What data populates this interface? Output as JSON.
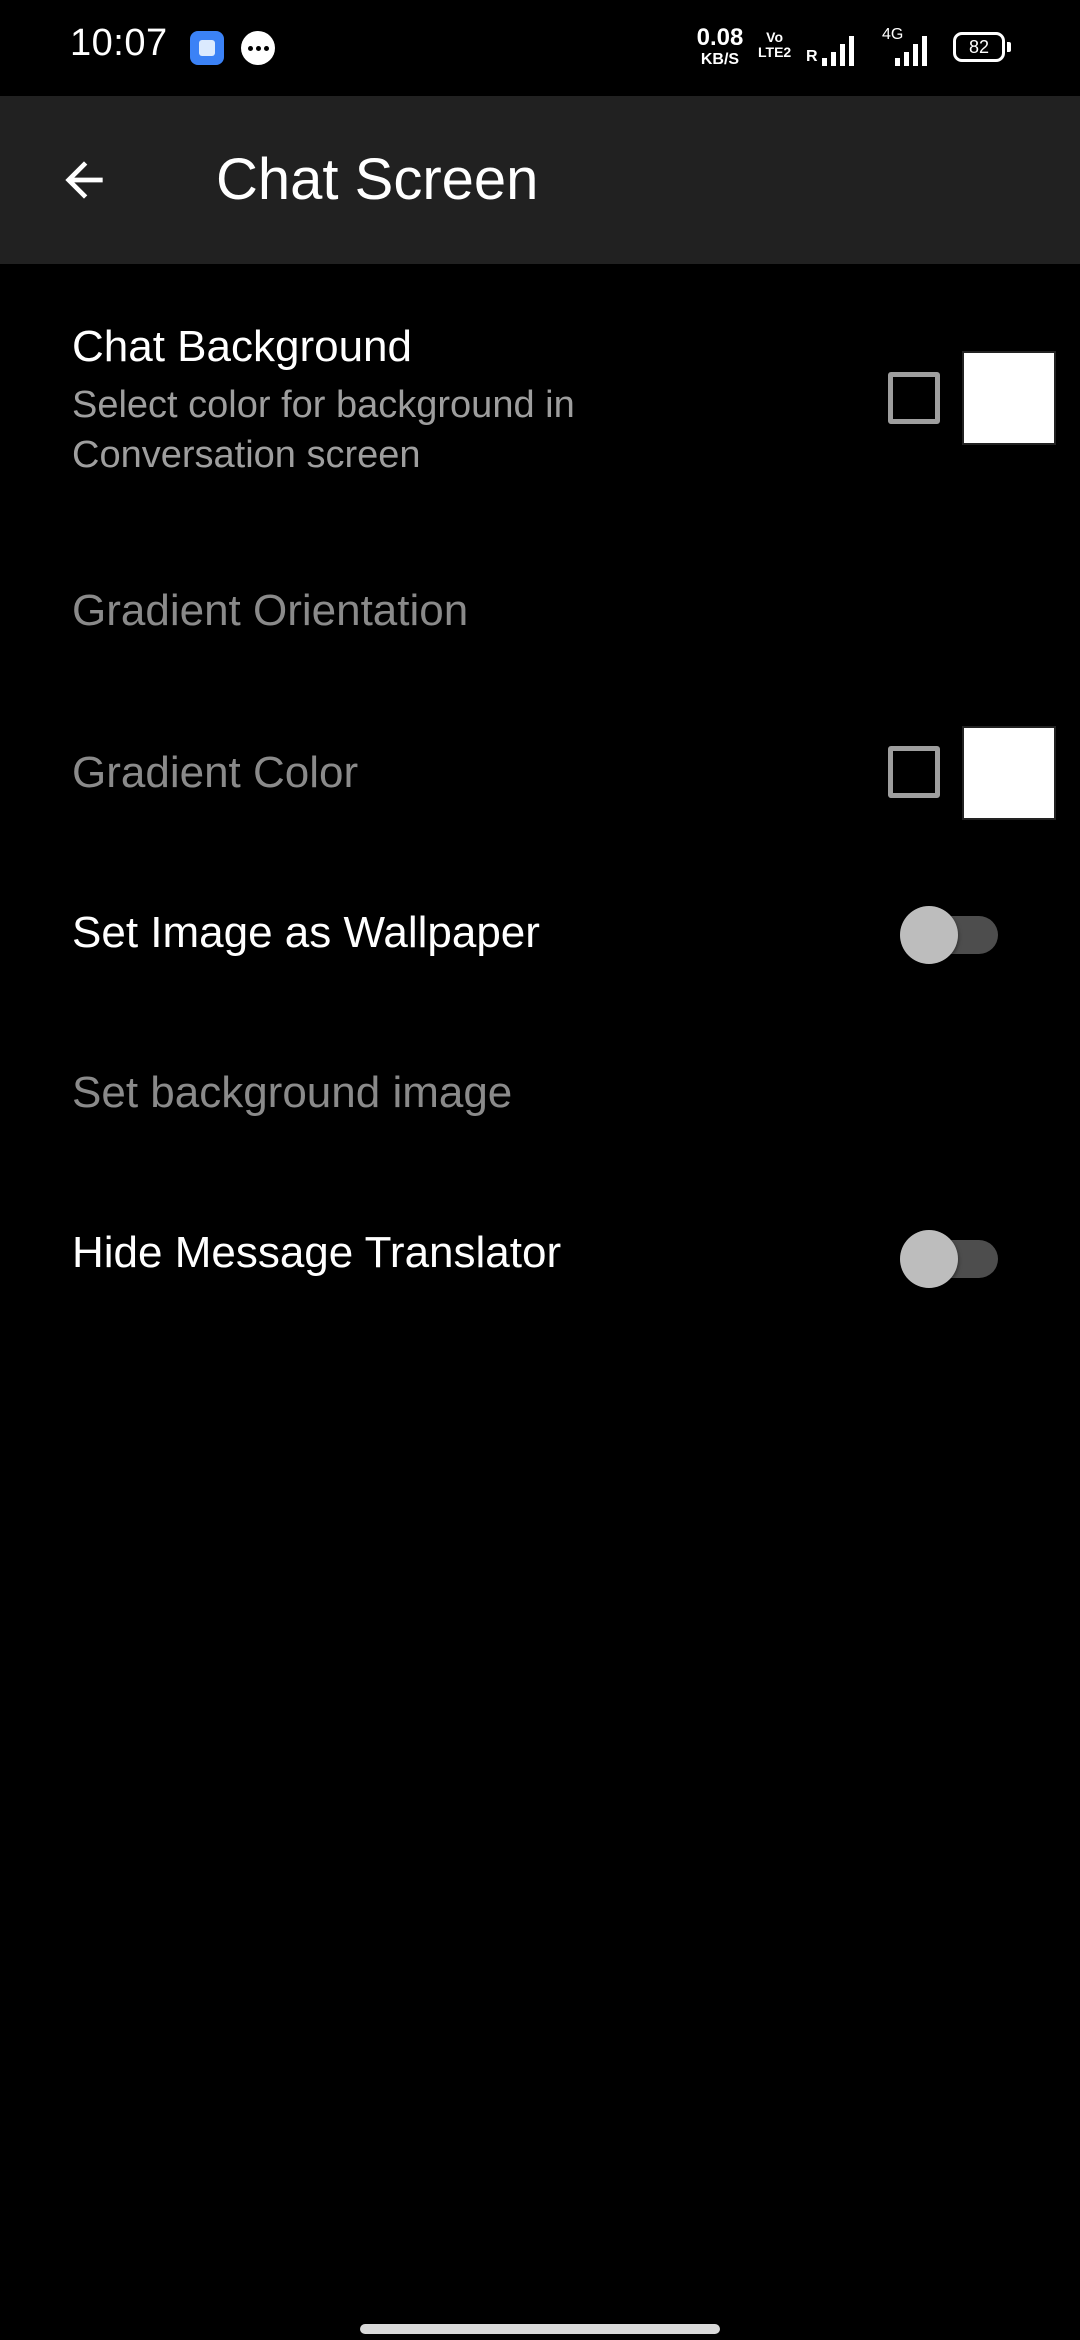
{
  "status_bar": {
    "time": "10:07",
    "net_speed_value": "0.08",
    "net_speed_unit": "KB/S",
    "volte_top": "Vo",
    "volte_bottom": "LTE2",
    "roaming": "R",
    "network_type": "4G",
    "battery": "82"
  },
  "app_bar": {
    "title": "Chat Screen"
  },
  "settings": [
    {
      "title": "Chat Background",
      "summary": "Select color for background in Conversation screen",
      "enabled": true,
      "checkbox_checked": false,
      "color": "#ffffff"
    },
    {
      "title": "Gradient Orientation",
      "enabled": false
    },
    {
      "title": "Gradient Color",
      "enabled": false,
      "checkbox_checked": false,
      "color": "#ffffff"
    },
    {
      "title": "Set Image as Wallpaper",
      "enabled": true,
      "switch_on": false
    },
    {
      "title": "Set background image",
      "enabled": false
    },
    {
      "title": "Hide Message Translator",
      "enabled": true,
      "switch_on": false
    }
  ],
  "colors": {
    "background": "#000000",
    "app_bar": "#212121",
    "text_primary": "#ffffff",
    "text_disabled": "#8a8a8a",
    "text_secondary": "#9e9e9e"
  }
}
